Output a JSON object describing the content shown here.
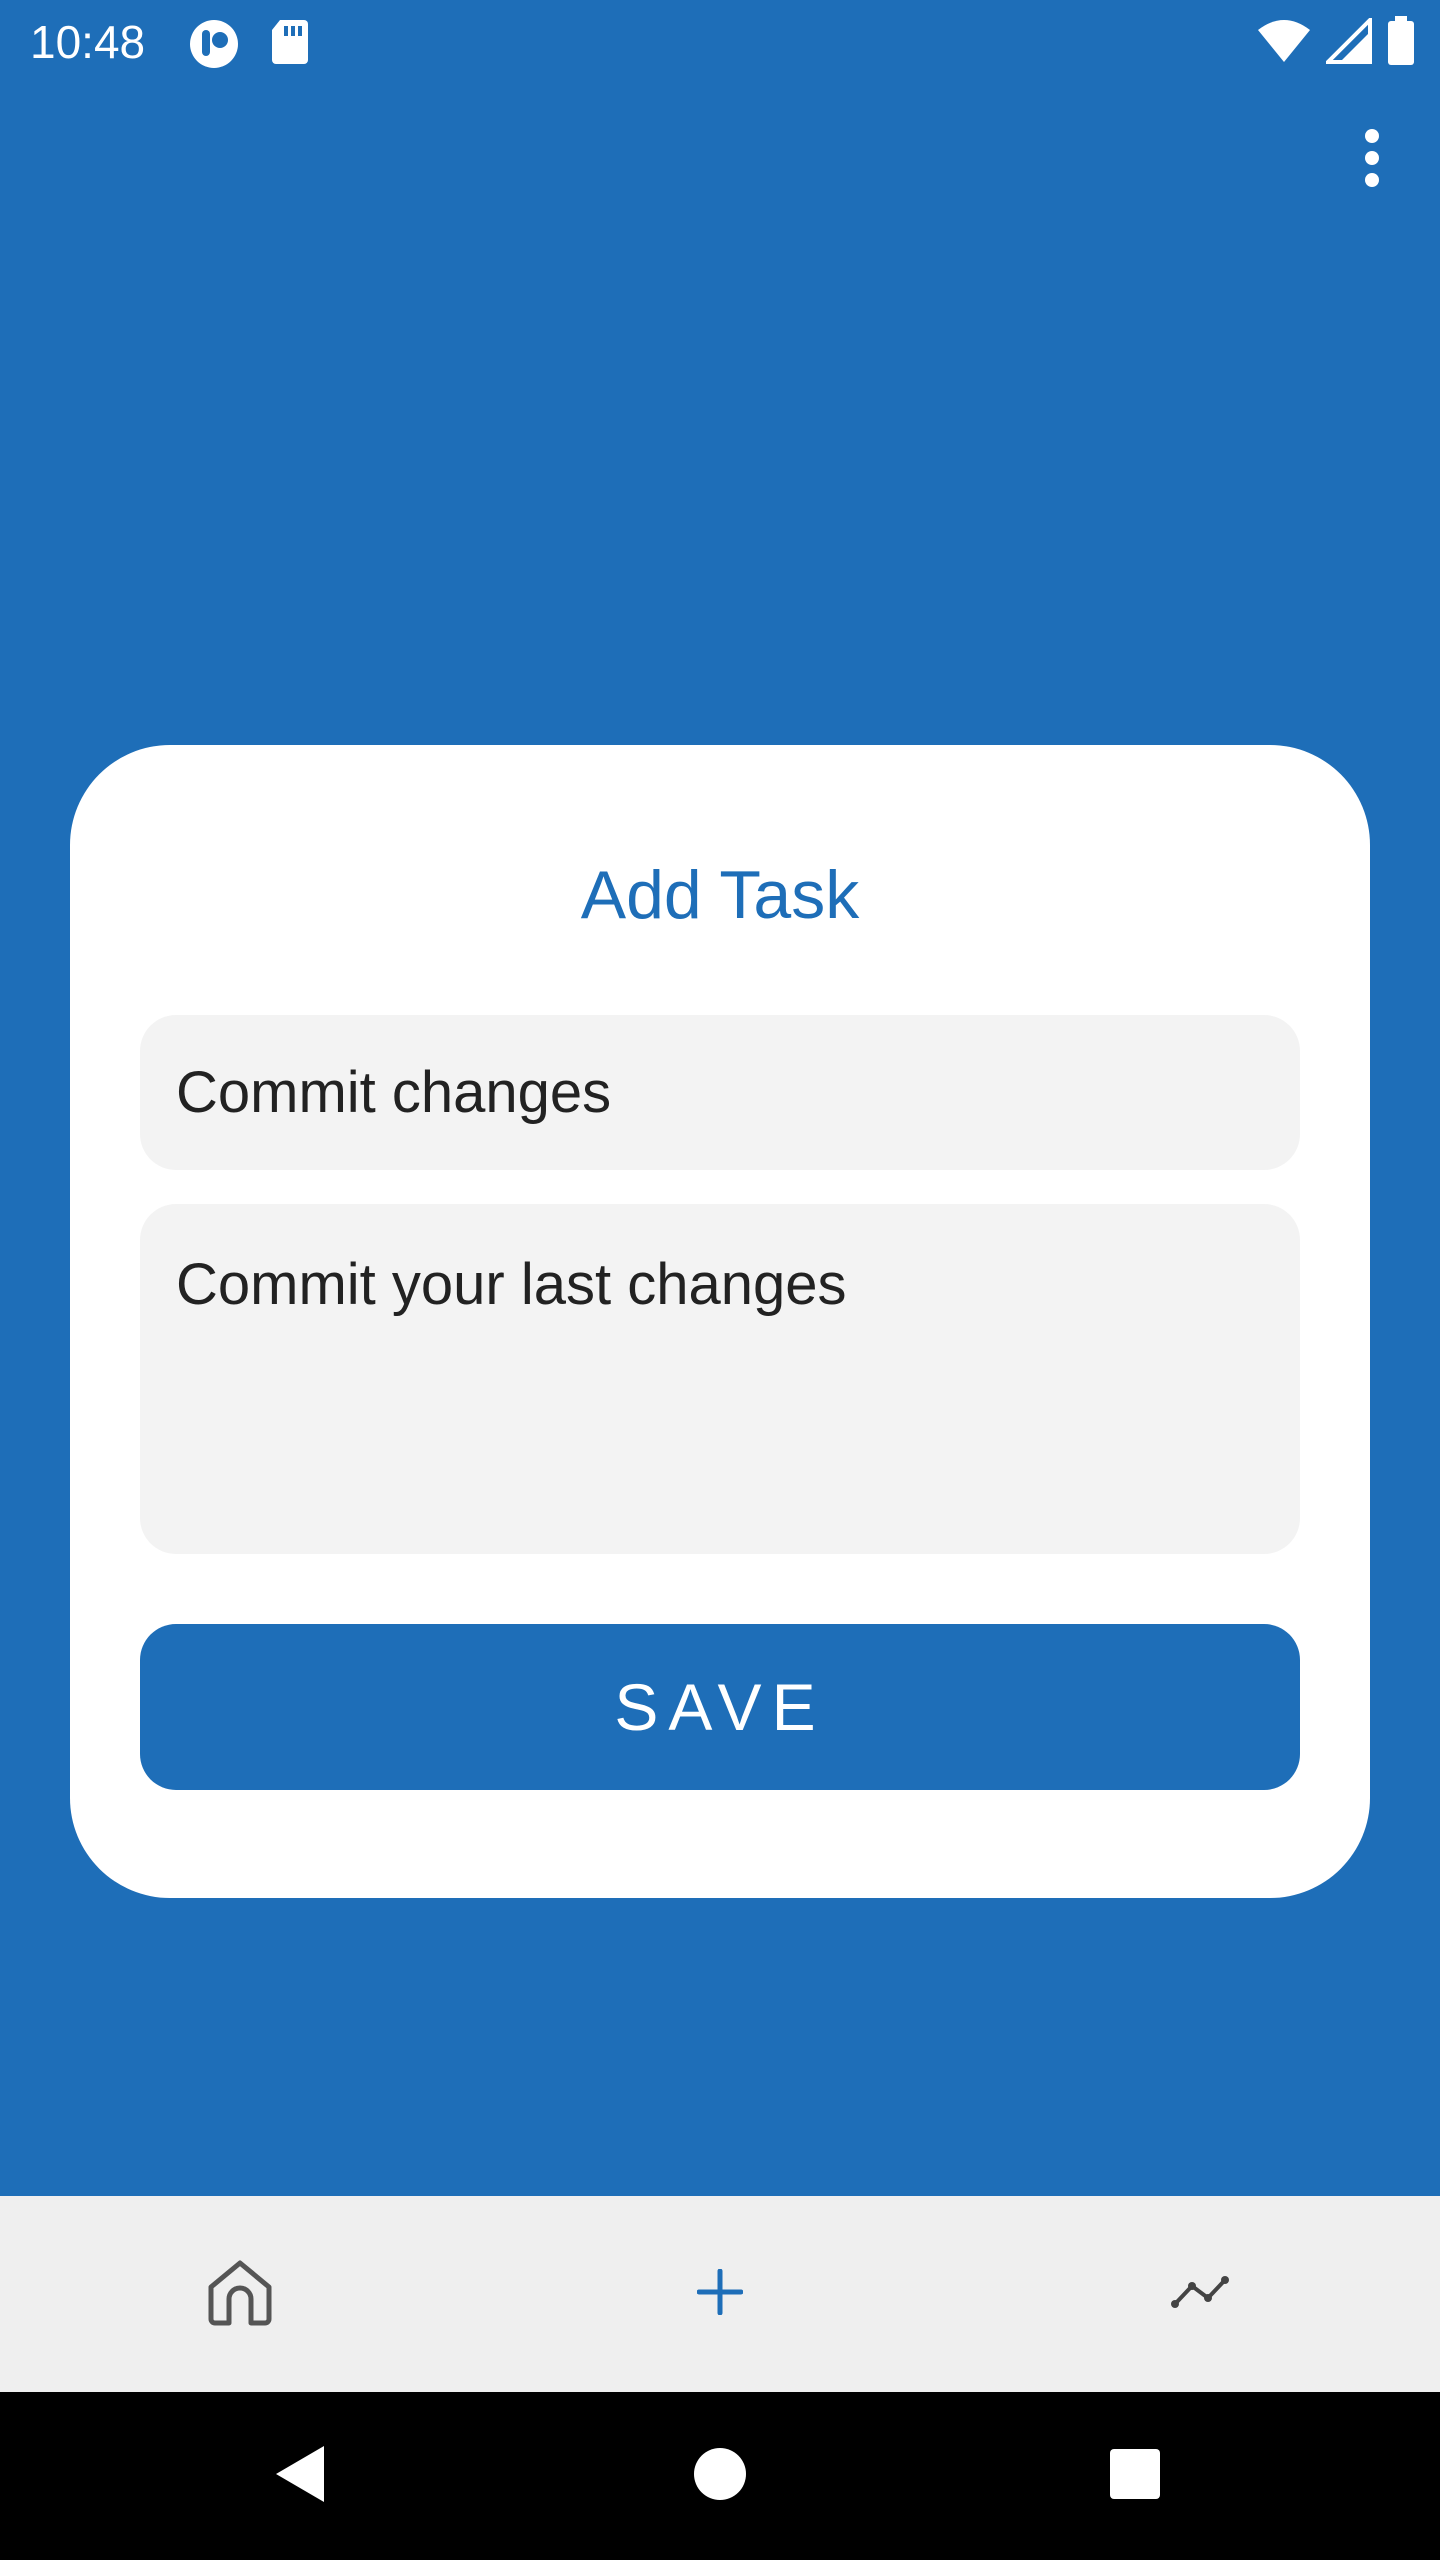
{
  "status_bar": {
    "time": "10:48",
    "left_icons": [
      "app-notification-icon",
      "sd-card-icon"
    ],
    "right_icons": [
      "wifi-icon",
      "cellular-signal-icon",
      "battery-icon"
    ]
  },
  "app_bar": {
    "menu_icon": "more-vert-icon"
  },
  "dialog": {
    "title": "Add Task",
    "task_title_value": "Commit changes",
    "task_description_value": "Commit your last changes",
    "save_label": "SAVE"
  },
  "bottom_nav": {
    "items": [
      {
        "icon": "home-icon",
        "active": false
      },
      {
        "icon": "add-icon",
        "active": true
      },
      {
        "icon": "trending-icon",
        "active": false
      }
    ]
  },
  "system_nav": [
    "back-icon",
    "home-circle-icon",
    "recents-icon"
  ],
  "colors": {
    "primary": "#1e6eb8",
    "surface": "#ffffff",
    "field": "#f3f3f3",
    "nav_bg": "#efefef"
  }
}
